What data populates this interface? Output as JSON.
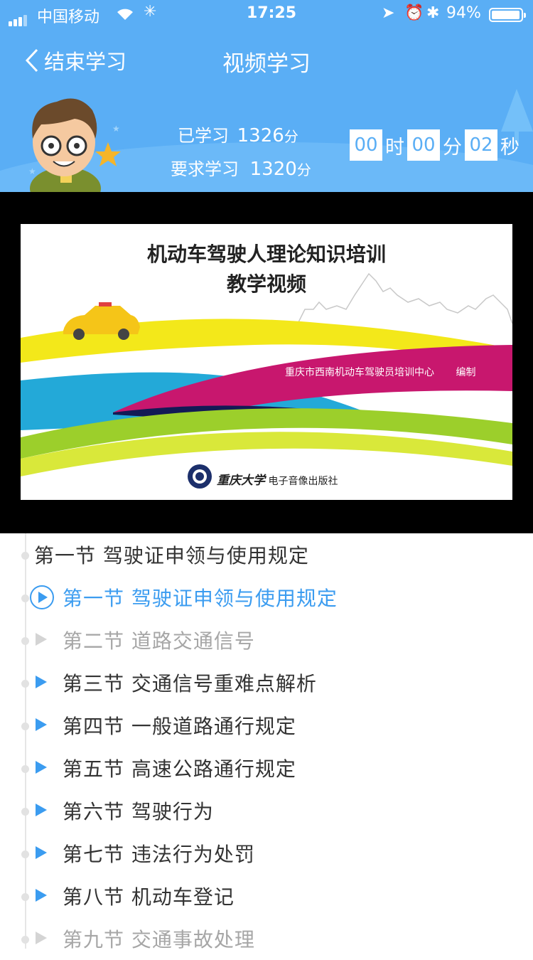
{
  "status_bar": {
    "carrier": "中国移动",
    "time": "17:25",
    "battery": "94%"
  },
  "nav": {
    "back_label": "结束学习",
    "title": "视频学习"
  },
  "study": {
    "learned_label": "已学习",
    "learned_value": "1326",
    "required_label": "要求学习",
    "required_value": "1320",
    "minute_unit": "分"
  },
  "timer": {
    "hours": "00",
    "hours_unit": "时",
    "minutes": "00",
    "minutes_unit": "分",
    "seconds": "02",
    "seconds_unit": "秒"
  },
  "video_slide": {
    "title_line1": "机动车驾驶人理论知识培训",
    "title_line2": "教学视频",
    "org": "重庆市西南机动车驾驶员培训中心",
    "org_suffix": "编制",
    "publisher_logo": "重庆大学",
    "publisher": "电子音像出版社"
  },
  "chapter_title": "第一节 驾驶证申领与使用规定",
  "lessons": [
    {
      "label": "第一节 驾驶证申领与使用规定",
      "state": "active"
    },
    {
      "label": "第二节 道路交通信号",
      "state": "disabled"
    },
    {
      "label": "第三节 交通信号重难点解析",
      "state": "available"
    },
    {
      "label": "第四节 一般道路通行规定",
      "state": "available"
    },
    {
      "label": "第五节 高速公路通行规定",
      "state": "available"
    },
    {
      "label": "第六节 驾驶行为",
      "state": "available"
    },
    {
      "label": "第七节 违法行为处罚",
      "state": "available"
    },
    {
      "label": "第八节 机动车登记",
      "state": "available"
    },
    {
      "label": "第九节 交通事故处理",
      "state": "disabled"
    }
  ],
  "colors": {
    "header_bg": "#5aaef5",
    "accent": "#3b9cf0",
    "disabled_text": "#a6a6a6"
  }
}
